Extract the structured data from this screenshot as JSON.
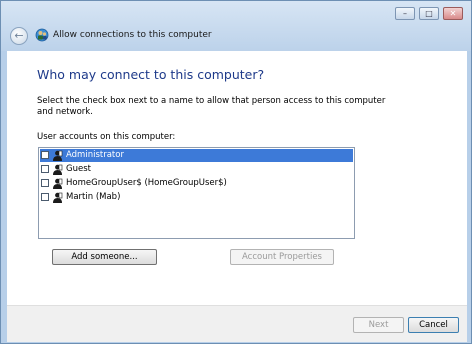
{
  "window": {
    "title": "Allow connections to this computer",
    "controls": {
      "minimize": "–",
      "maximize": "□",
      "close": "✕"
    },
    "back_glyph": "←"
  },
  "main": {
    "heading": "Who may connect to this computer?",
    "description": "Select the check box next to a name to allow that person access to this computer and network.",
    "list_label": "User accounts on this computer:",
    "accounts": [
      {
        "label": "Administrator",
        "checked": false,
        "selected": true
      },
      {
        "label": "Guest",
        "checked": false,
        "selected": false
      },
      {
        "label": "HomeGroupUser$ (HomeGroupUser$)",
        "checked": false,
        "selected": false
      },
      {
        "label": "Martin (Mab)",
        "checked": false,
        "selected": false
      }
    ],
    "add_button": "Add someone...",
    "properties_button": "Account Properties"
  },
  "footer": {
    "next_button": "Next",
    "cancel_button": "Cancel"
  },
  "colors": {
    "heading": "#1e3a8a",
    "selection": "#3d7ad8",
    "titlebar": "#c9dcf0"
  },
  "icons": [
    "back-arrow-icon",
    "network-users-icon",
    "user-icon",
    "checkbox-icon"
  ]
}
